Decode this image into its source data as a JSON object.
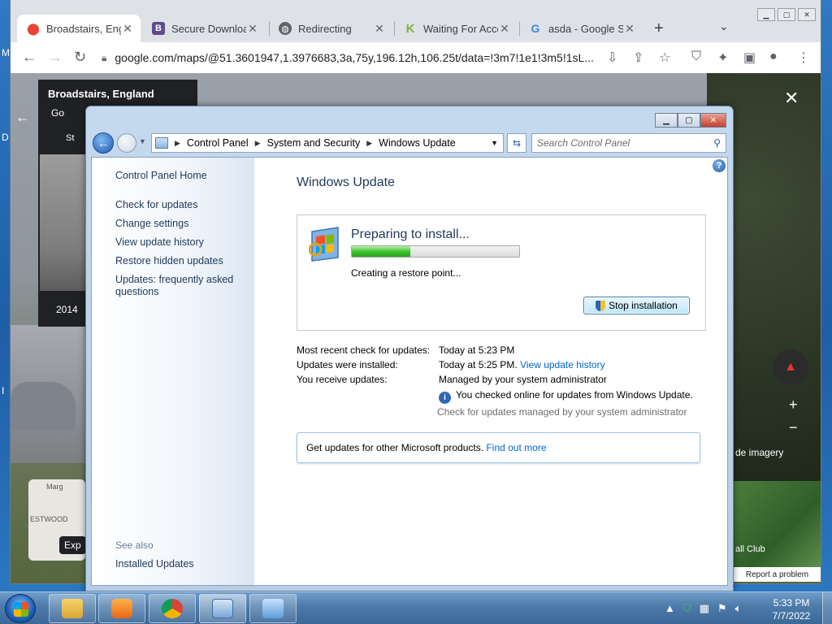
{
  "desktop": {
    "letters": [
      "M",
      "D",
      "I"
    ]
  },
  "browser": {
    "tabs": [
      {
        "title": "Broadstairs, Engl",
        "favicon": "maps-pin-icon",
        "active": true
      },
      {
        "title": "Secure Downloa",
        "favicon": "b-icon",
        "active": false
      },
      {
        "title": "Redirecting",
        "favicon": "globe-icon",
        "active": false
      },
      {
        "title": "Waiting For Acce",
        "favicon": "k-icon",
        "active": false
      },
      {
        "title": "asda - Google Se",
        "favicon": "google-g-icon",
        "active": false
      }
    ],
    "url": "google.com/maps/@51.3601947,1.3976683,3a,75y,196.12h,106.25t/data=!3m7!1e1!3m5!1sL..."
  },
  "maps": {
    "place_title": "Broadstairs, England",
    "subtitle": "Go",
    "year": "2014",
    "sv_date_label": "St",
    "imagery_label": "de imagery",
    "minimap_labels": [
      "Marg",
      "ESTWOOD"
    ],
    "expand_label": "Exp",
    "aerial_label": "all Club",
    "report_label": "Report a problem"
  },
  "control_panel": {
    "breadcrumb": [
      "Control Panel",
      "System and Security",
      "Windows Update"
    ],
    "search_placeholder": "Search Control Panel",
    "left_links": [
      "Control Panel Home",
      "Check for updates",
      "Change settings",
      "View update history",
      "Restore hidden updates",
      "Updates: frequently asked questions"
    ],
    "see_also_label": "See also",
    "see_also_links": [
      "Installed Updates"
    ],
    "title": "Windows Update",
    "status": {
      "heading": "Preparing to install...",
      "progress": 0.35,
      "message": "Creating a restore point...",
      "stop_button": "Stop installation"
    },
    "info": {
      "recent_check_label": "Most recent check for updates:",
      "recent_check_value": "Today at 5:23 PM",
      "installed_label": "Updates were installed:",
      "installed_value": "Today at 5:25 PM.",
      "history_link": "View update history",
      "receive_label": "You receive updates:",
      "receive_value": "Managed by your system administrator",
      "online_note": "You checked online for updates from Windows Update.",
      "managed_note": "Check for updates managed by your system administrator"
    },
    "get_updates_text": "Get updates for other Microsoft products.",
    "find_out_more": "Find out more"
  },
  "taskbar": {
    "time": "5:33 PM",
    "date": "7/7/2022"
  },
  "colors": {
    "progress_green": "#37c02a",
    "link_blue": "#0066cc",
    "heading_blue": "#1e395b"
  }
}
